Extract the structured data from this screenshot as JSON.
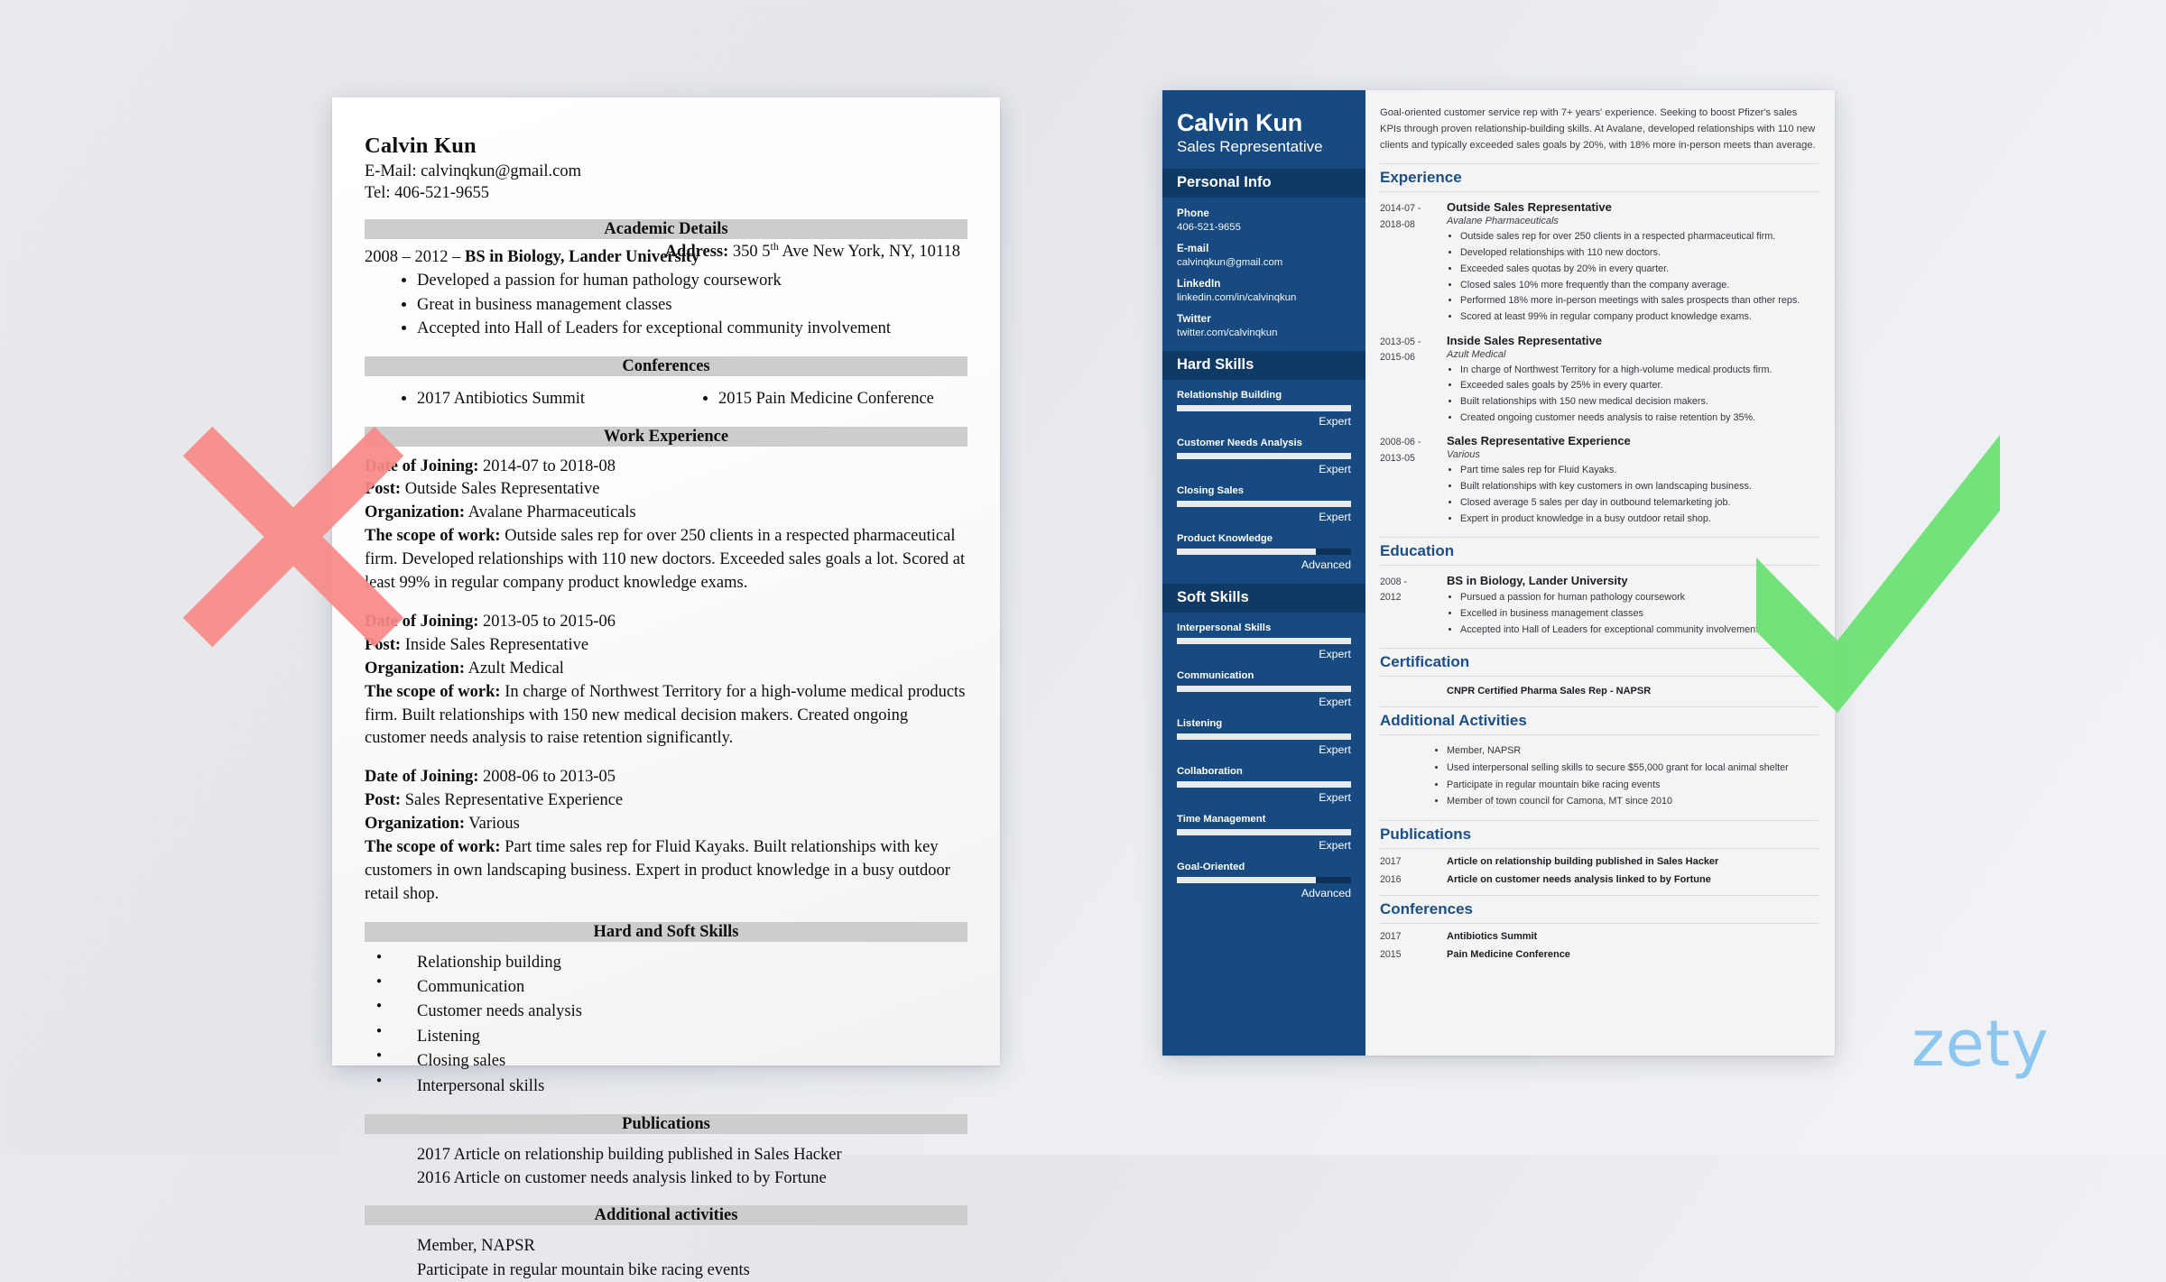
{
  "brand": {
    "logo_text": "zety",
    "logo_color": "#8dc7ef"
  },
  "colors": {
    "sidebar_bg": "#174a80",
    "sidebar_header_bg": "#103a66",
    "accent_heading": "#1b4f86",
    "cross_red": "#f98a86",
    "check_green": "#6de074",
    "section_bar_gray": "#cdcdcd"
  },
  "marks": {
    "cross": "cross-mark-red",
    "check": "check-mark-green"
  },
  "bad_resume": {
    "name": "Calvin Kun",
    "email_line": "E-Mail: calvinqkun@gmail.com",
    "tel_line": "Tel: 406-521-9655",
    "address_label": "Address:",
    "address_value_pre": "350 5",
    "address_value_sup": "th",
    "address_value_post": " Ave New York, NY, 10118",
    "sections": {
      "academic": "Academic Details",
      "conferences": "Conferences",
      "work": "Work Experience",
      "skills": "Hard and Soft Skills",
      "publications": "Publications",
      "additional": "Additional activities"
    },
    "education_heading_pre": "2008 – 2012 – ",
    "education_heading_bold": "BS in Biology, Lander University",
    "education_bullets": [
      "Developed a passion for human pathology coursework",
      "Great in business management classes",
      "Accepted into Hall of Leaders for exceptional community involvement"
    ],
    "conference_left": [
      "2017 Antibiotics Summit"
    ],
    "conference_right": [
      "2015 Pain Medicine Conference"
    ],
    "labels": {
      "date": "Date of Joining:",
      "post": "Post:",
      "org": "Organization:",
      "scope": "The scope of work:"
    },
    "jobs": [
      {
        "date": "2014-07 to 2018-08",
        "post": "Outside Sales Representative",
        "org": "Avalane Pharmaceuticals",
        "scope": "Outside sales rep for over 250 clients in a respected pharmaceutical firm. Developed relationships with 110 new doctors. Exceeded sales goals a lot. Scored at least 99% in regular company product knowledge exams."
      },
      {
        "date": "2013-05 to 2015-06",
        "post": "Inside Sales Representative",
        "org": "Azult Medical",
        "scope": "In charge of Northwest Territory for a high-volume medical products firm. Built relationships with 150 new medical decision makers. Created ongoing customer needs analysis to raise retention significantly."
      },
      {
        "date": "2008-06 to 2013-05",
        "post": "Sales Representative Experience",
        "org": "Various",
        "scope": "Part time sales rep for Fluid Kayaks. Built relationships with key customers in own landscaping business. Expert in product knowledge in a busy outdoor retail shop."
      }
    ],
    "skills_list": [
      "Relationship building",
      "Communication",
      "Customer needs analysis",
      "Listening",
      "Closing sales",
      "Interpersonal skills"
    ],
    "publications": [
      "2017 Article on relationship building published in Sales Hacker",
      "2016 Article on customer needs analysis linked to by Fortune"
    ],
    "additional": [
      "Member, NAPSR",
      "Participate in regular mountain bike racing events"
    ]
  },
  "good_resume": {
    "name": "Calvin Kun",
    "title": "Sales Representative",
    "sidebar": {
      "personal_info_header": "Personal Info",
      "fields": [
        {
          "label": "Phone",
          "value": "406-521-9655"
        },
        {
          "label": "E-mail",
          "value": "calvinqkun@gmail.com"
        },
        {
          "label": "LinkedIn",
          "value": "linkedin.com/in/calvinqkun"
        },
        {
          "label": "Twitter",
          "value": "twitter.com/calvinqkun"
        }
      ],
      "hard_skills_header": "Hard Skills",
      "hard_skills": [
        {
          "name": "Relationship Building",
          "level": "Expert",
          "pct": 100
        },
        {
          "name": "Customer Needs Analysis",
          "level": "Expert",
          "pct": 100
        },
        {
          "name": "Closing Sales",
          "level": "Expert",
          "pct": 100
        },
        {
          "name": "Product Knowledge",
          "level": "Advanced",
          "pct": 80
        }
      ],
      "soft_skills_header": "Soft Skills",
      "soft_skills": [
        {
          "name": "Interpersonal Skills",
          "level": "Expert",
          "pct": 100
        },
        {
          "name": "Communication",
          "level": "Expert",
          "pct": 100
        },
        {
          "name": "Listening",
          "level": "Expert",
          "pct": 100
        },
        {
          "name": "Collaboration",
          "level": "Expert",
          "pct": 100
        },
        {
          "name": "Time Management",
          "level": "Expert",
          "pct": 100
        },
        {
          "name": "Goal-Oriented",
          "level": "Advanced",
          "pct": 80
        }
      ]
    },
    "summary": "Goal-oriented customer service rep with 7+ years' experience. Seeking to boost Pfizer's sales KPIs through proven relationship-building skills. At Avalane, developed relationships with 110 new clients and typically exceeded sales goals by 20%, with 18% more in-person meets than average.",
    "sections": {
      "experience": "Experience",
      "education": "Education",
      "certification": "Certification",
      "additional": "Additional Activities",
      "publications": "Publications",
      "conferences": "Conferences"
    },
    "experience": [
      {
        "dates": "2014-07 -\n2018-08",
        "role": "Outside Sales Representative",
        "org": "Avalane Pharmaceuticals",
        "bullets": [
          "Outside sales rep for over 250 clients in a respected pharmaceutical firm.",
          "Developed relationships with 110 new doctors.",
          "Exceeded sales quotas by 20% in every quarter.",
          "Closed sales 10% more frequently than the company average.",
          "Performed 18% more in-person meetings with sales prospects than other reps.",
          "Scored at least 99% in regular company product knowledge exams."
        ]
      },
      {
        "dates": "2013-05 -\n2015-06",
        "role": "Inside Sales Representative",
        "org": "Azult Medical",
        "bullets": [
          "In charge of Northwest Territory for a high-volume medical products firm.",
          "Exceeded sales goals by 25% in every quarter.",
          "Built relationships with 150 new medical decision makers.",
          "Created ongoing customer needs analysis to raise retention by 35%."
        ]
      },
      {
        "dates": "2008-06 -\n2013-05",
        "role": "Sales Representative Experience",
        "org": "Various",
        "bullets": [
          "Part time sales rep for Fluid Kayaks.",
          "Built relationships with key customers in own landscaping business.",
          "Closed average 5 sales per day in outbound telemarketing job.",
          "Expert in product knowledge in a busy outdoor retail shop."
        ]
      }
    ],
    "education": [
      {
        "dates": "2008 -\n2012",
        "role": "BS in Biology, Lander University",
        "org": "",
        "bullets": [
          "Pursued a passion for human pathology coursework",
          "Excelled in business management classes",
          "Accepted into Hall of Leaders for exceptional community involvement"
        ]
      }
    ],
    "certification": "CNPR Certified Pharma Sales Rep - NAPSR",
    "additional_activities": [
      "Member, NAPSR",
      "Used interpersonal selling skills to secure $55,000 grant for local animal shelter",
      "Participate in regular mountain bike racing events",
      "Member of town council for Camona, MT since 2010"
    ],
    "publications": [
      {
        "year": "2017",
        "text": "Article on relationship building published in Sales Hacker"
      },
      {
        "year": "2016",
        "text": "Article on customer needs analysis linked to by Fortune"
      }
    ],
    "conferences": [
      {
        "year": "2017",
        "text": "Antibiotics Summit"
      },
      {
        "year": "2015",
        "text": "Pain Medicine Conference"
      }
    ]
  }
}
